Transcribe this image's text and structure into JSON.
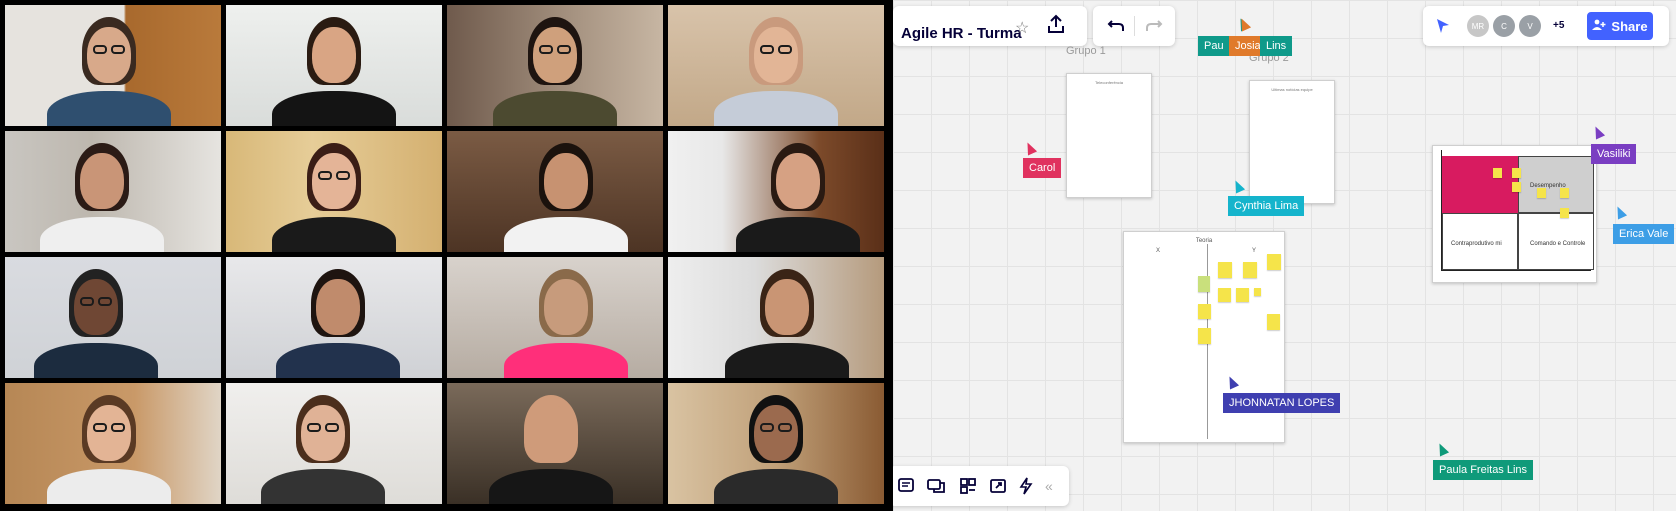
{
  "video": {
    "participants": [
      {
        "name": "participant-1"
      },
      {
        "name": "participant-2"
      },
      {
        "name": "participant-3"
      },
      {
        "name": "participant-4"
      },
      {
        "name": "participant-5"
      },
      {
        "name": "participant-6"
      },
      {
        "name": "participant-7"
      },
      {
        "name": "participant-8"
      },
      {
        "name": "participant-9"
      },
      {
        "name": "participant-10"
      },
      {
        "name": "participant-11"
      },
      {
        "name": "participant-12"
      },
      {
        "name": "participant-13"
      },
      {
        "name": "participant-14"
      },
      {
        "name": "participant-15"
      },
      {
        "name": "participant-16"
      }
    ]
  },
  "board": {
    "title": "Agile HR - Turma",
    "star_icon": "star-icon",
    "export_icon": "upload-icon",
    "undo_icon": "undo-icon",
    "redo_icon": "redo-icon",
    "collaborators": {
      "avatars": [
        {
          "initials": "MR",
          "color": "#c7c7c7"
        },
        {
          "initials": "C",
          "color": "#9aa0a6"
        },
        {
          "initials": "V",
          "color": "#9aa0a6"
        }
      ],
      "more": "+5"
    },
    "share_label": "Share",
    "frames": {
      "grupo1": "Grupo 1",
      "grupo2": "Grupo 2",
      "doc1_title": "Teleconferência",
      "doc2_title": "Ultimas notícias equipe",
      "teoria_title": "Teoria",
      "teoria_x": "X",
      "teoria_y": "Y"
    },
    "matrix": {
      "top_right": "Desempenho",
      "bottom_left": "Contraprodutivo mi",
      "bottom_right": "Comando e Controle"
    },
    "cursors": [
      {
        "label": "Pau",
        "color": "#0f9a8a"
      },
      {
        "label": "Josiana",
        "color": "#e07a2b"
      },
      {
        "label": "Lins",
        "color": "#0f9a8a"
      },
      {
        "label": "Carol",
        "color": "#e0325f"
      },
      {
        "label": "Cynthia Lima",
        "color": "#15b4cc"
      },
      {
        "label": "Vasiliki",
        "color": "#7a3ec2"
      },
      {
        "label": "Erica Vale",
        "color": "#3d9ee6"
      },
      {
        "label": "JHONNATAN LOPES",
        "color": "#3f3fb0"
      },
      {
        "label": "Paula Freitas Lins",
        "color": "#0f9a7a"
      }
    ],
    "toolbar": {
      "icons": [
        "comment-icon",
        "chat-icon",
        "grid-icon",
        "screen-share-icon",
        "lightning-icon",
        "collapse-icon"
      ]
    },
    "colors": {
      "brand": "#4262ff",
      "sticky": "#f5e44a",
      "matrix_pink": "#d81b60"
    }
  }
}
